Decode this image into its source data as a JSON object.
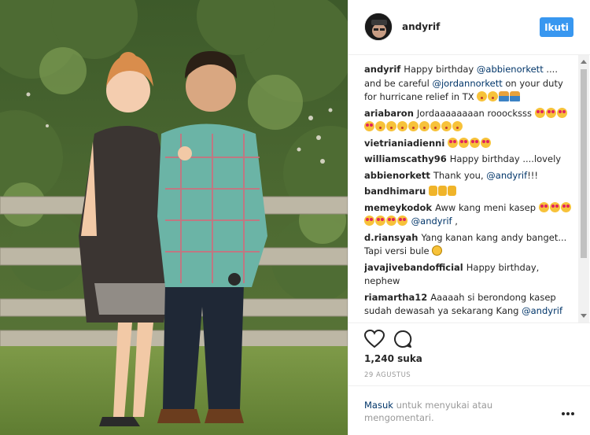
{
  "post": {
    "username": "andyrif",
    "follow_label": "Ikuti",
    "likes": "1,240 suka",
    "date": "29 AGUSTUS"
  },
  "comments": [
    {
      "user": "andyrif",
      "parts": [
        {
          "t": "text",
          "v": "Happy birthday "
        },
        {
          "t": "mention",
          "v": "@abbienorkett"
        },
        {
          "t": "text",
          "v": " .... and be careful "
        },
        {
          "t": "mention",
          "v": "@jordannorkett"
        },
        {
          "t": "text",
          "v": " on your duty for hurricane relief in TX "
        },
        {
          "t": "emoji",
          "v": "kiss"
        },
        {
          "t": "emoji",
          "v": "kiss"
        },
        {
          "t": "emoji",
          "v": "pray"
        },
        {
          "t": "emoji",
          "v": "pray"
        }
      ]
    },
    {
      "user": "ariabaron",
      "parts": [
        {
          "t": "text",
          "v": "Jordaaaaaaaan roooc​ksss "
        },
        {
          "t": "emoji",
          "v": "heart"
        },
        {
          "t": "emoji",
          "v": "heart"
        },
        {
          "t": "emoji",
          "v": "heart"
        },
        {
          "t": "emoji",
          "v": "heart"
        },
        {
          "t": "emoji",
          "v": "kiss"
        },
        {
          "t": "emoji",
          "v": "kiss"
        },
        {
          "t": "emoji",
          "v": "kiss"
        },
        {
          "t": "emoji",
          "v": "kiss"
        },
        {
          "t": "emoji",
          "v": "kiss"
        },
        {
          "t": "emoji",
          "v": "kiss"
        },
        {
          "t": "emoji",
          "v": "kiss"
        },
        {
          "t": "emoji",
          "v": "kiss"
        }
      ]
    },
    {
      "user": "vietrianiadienni",
      "parts": [
        {
          "t": "emoji",
          "v": "heart"
        },
        {
          "t": "emoji",
          "v": "heart"
        },
        {
          "t": "emoji",
          "v": "heart"
        },
        {
          "t": "emoji",
          "v": "heart"
        }
      ]
    },
    {
      "user": "williamscathy96",
      "parts": [
        {
          "t": "text",
          "v": "Happy birthday ....lovely"
        }
      ]
    },
    {
      "user": "abbienorkett",
      "parts": [
        {
          "t": "text",
          "v": "Thank you, "
        },
        {
          "t": "mention",
          "v": "@andyrif"
        },
        {
          "t": "text",
          "v": "!!!"
        }
      ]
    },
    {
      "user": "bandhimaru",
      "parts": [
        {
          "t": "emoji",
          "v": "thumb"
        },
        {
          "t": "emoji",
          "v": "thumb"
        },
        {
          "t": "emoji",
          "v": "thumb"
        }
      ]
    },
    {
      "user": "memeykodok",
      "parts": [
        {
          "t": "text",
          "v": "Aww kang meni kasep "
        },
        {
          "t": "emoji",
          "v": "heart"
        },
        {
          "t": "emoji",
          "v": "heart"
        },
        {
          "t": "emoji",
          "v": "heart"
        },
        {
          "t": "emoji",
          "v": "heart"
        },
        {
          "t": "emoji",
          "v": "heart"
        },
        {
          "t": "emoji",
          "v": "heart"
        },
        {
          "t": "emoji",
          "v": "heart"
        },
        {
          "t": "text",
          "v": " "
        },
        {
          "t": "mention",
          "v": "@andyrif"
        },
        {
          "t": "text",
          "v": " ,"
        }
      ]
    },
    {
      "user": "d.riansyah",
      "parts": [
        {
          "t": "text",
          "v": "Yang kanan kang andy banget... Tapi versi bule "
        },
        {
          "t": "emoji",
          "v": "grin"
        }
      ]
    },
    {
      "user": "javajivebandofficial",
      "parts": [
        {
          "t": "text",
          "v": "Happy birthday, nephew"
        }
      ]
    },
    {
      "user": "riamartha12",
      "parts": [
        {
          "t": "text",
          "v": "Aaaaah si berondong kasep sudah dewasah ya sekarang Kang "
        },
        {
          "t": "mention",
          "v": "@andyrif"
        }
      ]
    }
  ],
  "footer": {
    "login_link": "Masuk",
    "login_text": " untuk menyukai atau mengomentari."
  },
  "icons": {
    "like": "heart-icon",
    "comment": "comment-bubble-icon",
    "more": "more-options-icon"
  },
  "colors": {
    "accent": "#3897f0",
    "link": "#003569",
    "muted": "#999999"
  }
}
